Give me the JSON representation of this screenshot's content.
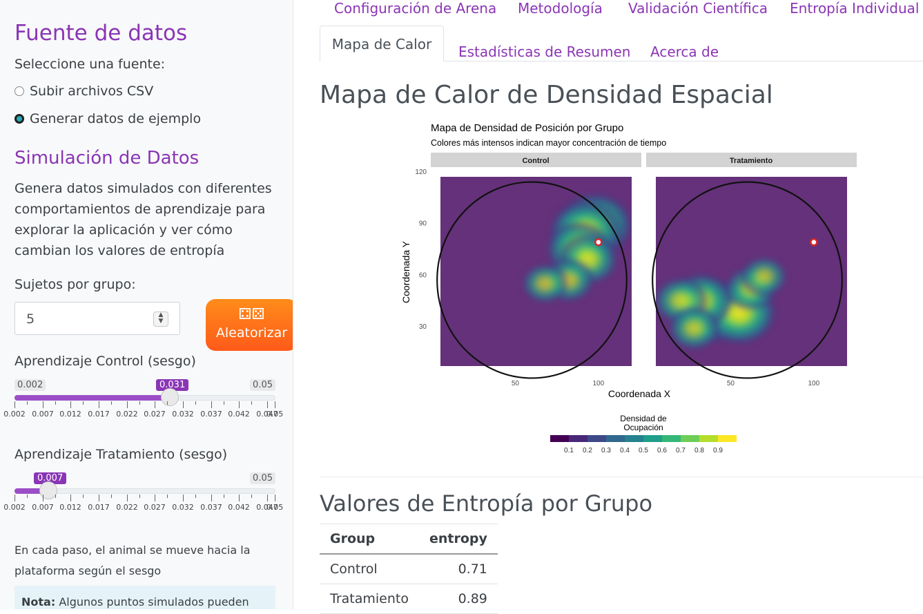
{
  "sidebar": {
    "data_source": {
      "title": "Fuente de datos",
      "prompt": "Seleccione una fuente:",
      "options": [
        "Subir archivos CSV",
        "Generar datos de ejemplo"
      ],
      "selected": "Generar datos de ejemplo"
    },
    "simulation": {
      "title": "Simulación de Datos",
      "description": "Genera datos simulados con diferentes comportamientos de aprendizaje para explorar la aplicación y ver cómo cambian los valores de entropía",
      "subjects_label": "Sujetos por grupo:",
      "subjects_value": "5",
      "randomize_icon": "dice-icon",
      "randomize_label": "Aleatorizar",
      "slider_control": {
        "label": "Aprendizaje Control (sesgo)",
        "min": "0.002",
        "max": "0.05",
        "value": "0.031",
        "ticks": [
          "0.002",
          "0.007",
          "0.012",
          "0.017",
          "0.022",
          "0.027",
          "0.032",
          "0.037",
          "0.042",
          "0.047",
          "0.05"
        ]
      },
      "slider_treatment": {
        "label": "Aprendizaje Tratamiento (sesgo)",
        "min": "0.002",
        "max": "0.05",
        "value": "0.007",
        "ticks": [
          "0.002",
          "0.007",
          "0.012",
          "0.017",
          "0.022",
          "0.027",
          "0.032",
          "0.037",
          "0.042",
          "0.047",
          "0.05"
        ]
      },
      "step_note": "En cada paso, el animal se mueve hacia la plataforma según el sesgo",
      "note_label": "Nota:",
      "note_text": "Algunos puntos simulados pueden"
    }
  },
  "nav": {
    "top_tabs": [
      "Configuración de Arena",
      "Metodología",
      "Validación Científica",
      "Entropía Individual"
    ],
    "tabs": [
      "Mapa de Calor",
      "Estadísticas de Resumen",
      "Acerca de"
    ],
    "active_tab": "Mapa de Calor"
  },
  "main": {
    "heatmap_title": "Mapa de Calor de Densidad Espacial",
    "entropy_title": "Valores de Entropía por Grupo",
    "table": {
      "columns": [
        "Group",
        "entropy"
      ],
      "rows": [
        [
          "Control",
          "0.71"
        ],
        [
          "Tratamiento",
          "0.89"
        ]
      ]
    }
  },
  "chart_data": {
    "type": "heatmap",
    "title": "Mapa de Densidad de Posición por Grupo",
    "subtitle": "Colores más intensos indican mayor concentración de tiempo",
    "xlabel": "Coordenada X",
    "ylabel": "Coordenada Y",
    "facets": [
      "Control",
      "Tratamiento"
    ],
    "x_ticks": [
      50,
      100
    ],
    "y_ticks": [
      30,
      60,
      90,
      120
    ],
    "xlim": [
      5,
      120
    ],
    "ylim": [
      10,
      120
    ],
    "arena": {
      "center_x": 60,
      "center_y": 60,
      "radius": 57
    },
    "platform": {
      "x": 100,
      "y": 82,
      "color": "#d62728"
    },
    "hotspots": {
      "Control": [
        {
          "x": 98,
          "y": 92,
          "density": 0.9
        },
        {
          "x": 92,
          "y": 88,
          "density": 0.85
        },
        {
          "x": 88,
          "y": 78,
          "density": 0.7
        },
        {
          "x": 94,
          "y": 72,
          "density": 0.6
        },
        {
          "x": 82,
          "y": 60,
          "density": 0.45
        },
        {
          "x": 68,
          "y": 58,
          "density": 0.35
        }
      ],
      "Tratamiento": [
        {
          "x": 38,
          "y": 42,
          "density": 0.9
        },
        {
          "x": 55,
          "y": 41,
          "density": 0.9
        },
        {
          "x": 32,
          "y": 48,
          "density": 0.7
        },
        {
          "x": 20,
          "y": 48,
          "density": 0.5
        },
        {
          "x": 28,
          "y": 32,
          "density": 0.45
        },
        {
          "x": 62,
          "y": 55,
          "density": 0.45
        },
        {
          "x": 70,
          "y": 62,
          "density": 0.35
        }
      ]
    },
    "legend": {
      "title": "Densidad de Ocupación",
      "breaks": [
        "0.1",
        "0.2",
        "0.3",
        "0.4",
        "0.5",
        "0.6",
        "0.7",
        "0.8",
        "0.9"
      ],
      "colors": [
        "#440154",
        "#482878",
        "#3e4989",
        "#31688e",
        "#26828e",
        "#1f9e89",
        "#35b779",
        "#6ece58",
        "#b5de2b",
        "#fde725"
      ]
    }
  }
}
